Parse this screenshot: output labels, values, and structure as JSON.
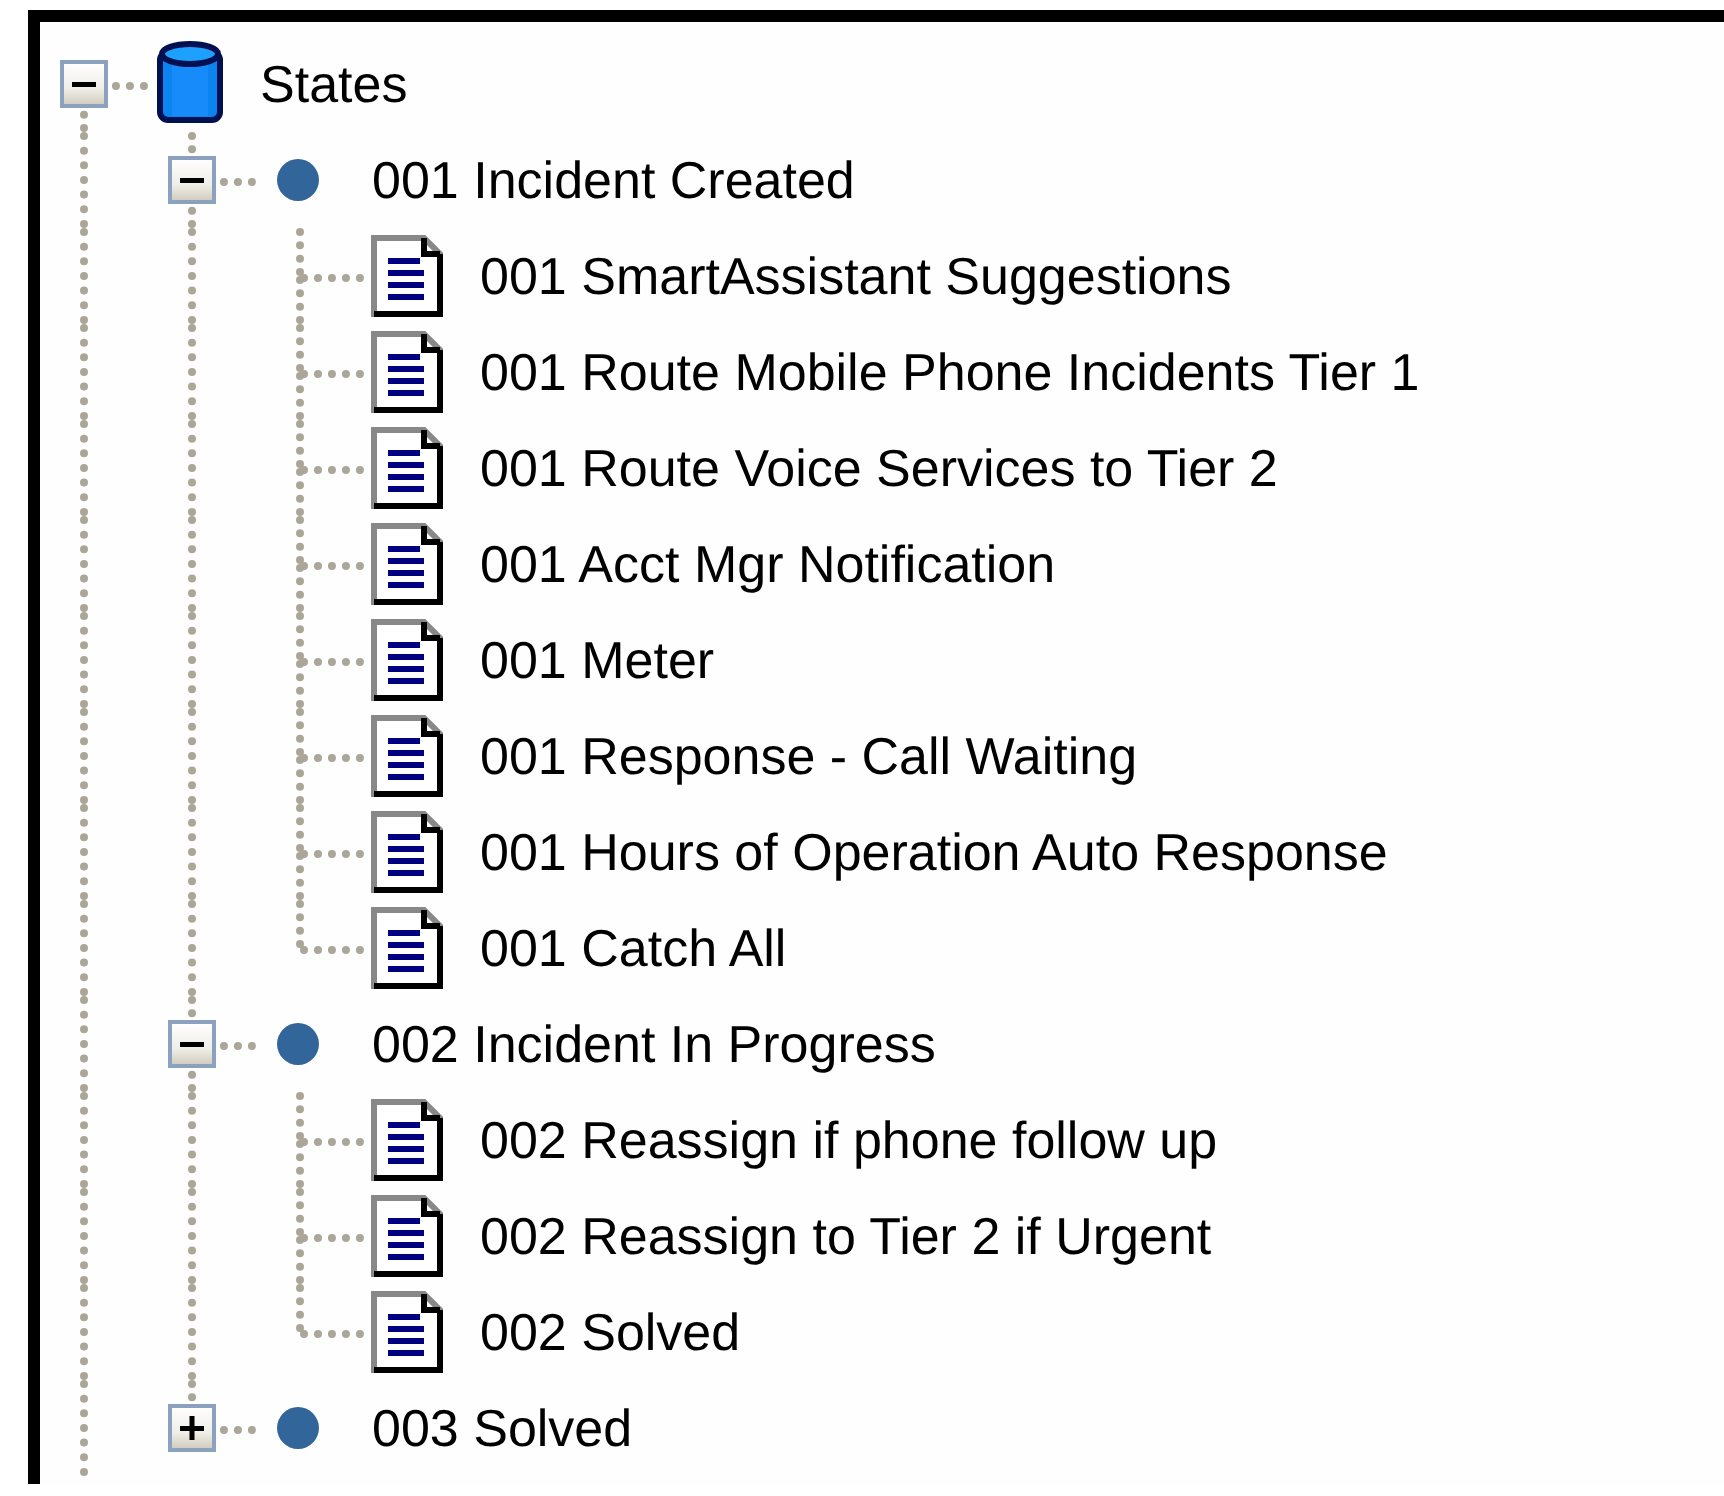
{
  "tree": [
    {
      "label": "States",
      "kind": "database",
      "expanded": true,
      "children": [
        {
          "label": "001 Incident Created",
          "kind": "state",
          "expanded": true,
          "children": [
            {
              "label": "001 SmartAssistant Suggestions",
              "kind": "rule"
            },
            {
              "label": "001 Route Mobile Phone Incidents Tier 1",
              "kind": "rule"
            },
            {
              "label": "001 Route Voice Services to Tier 2",
              "kind": "rule"
            },
            {
              "label": "001 Acct Mgr Notification",
              "kind": "rule"
            },
            {
              "label": "001 Meter",
              "kind": "rule"
            },
            {
              "label": "001 Response - Call Waiting",
              "kind": "rule"
            },
            {
              "label": "001 Hours of Operation Auto Response",
              "kind": "rule"
            },
            {
              "label": "001 Catch All",
              "kind": "rule"
            }
          ]
        },
        {
          "label": "002 Incident In Progress",
          "kind": "state",
          "expanded": true,
          "children": [
            {
              "label": "002 Reassign if phone follow up",
              "kind": "rule"
            },
            {
              "label": "002 Reassign to Tier 2 if Urgent",
              "kind": "rule"
            },
            {
              "label": "002 Solved",
              "kind": "rule"
            }
          ]
        },
        {
          "label": "003 Solved",
          "kind": "state",
          "expanded": false
        }
      ]
    }
  ]
}
